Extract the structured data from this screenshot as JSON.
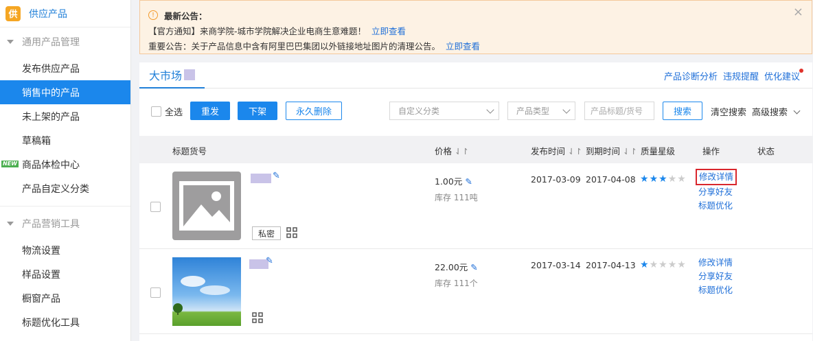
{
  "sidebar": {
    "logo_glyph": "供",
    "header_label": "供应产品",
    "groups": [
      {
        "label": "通用产品管理",
        "items": [
          "发布供应产品",
          "销售中的产品",
          "未上架的产品",
          "草稿箱",
          "商品体检中心",
          "产品自定义分类"
        ]
      },
      {
        "label": "产品营销工具",
        "items": [
          "物流设置",
          "样品设置",
          "橱窗产品",
          "标题优化工具"
        ]
      }
    ],
    "active_item": "销售中的产品",
    "new_badge": "NEW"
  },
  "notice": {
    "title": "最新公告：",
    "line1": "【官方通知】来商学院-城市学院解决企业电商生意难题！",
    "line1_link": "立即查看",
    "line2": "重要公告：关于产品信息中含有阿里巴巴集团以外链接地址图片的清理公告。",
    "line2_link": "立即查看",
    "close_glyph": "×",
    "warn_glyph": "!"
  },
  "tabs": {
    "active": "大市场"
  },
  "top_links": {
    "diagnose": "产品诊断分析",
    "violation": "违规提醒",
    "optimize": "优化建议"
  },
  "toolbar": {
    "select_all": "全选",
    "republish": "重发",
    "delist": "下架",
    "delete_forever": "永久删除",
    "category_placeholder": "自定义分类",
    "type_placeholder": "产品类型",
    "search_placeholder": "产品标题/货号",
    "search_button": "搜索",
    "clear_search": "清空搜索",
    "advanced_search": "高级搜索"
  },
  "table": {
    "headers": {
      "title": "标题货号",
      "price": "价格",
      "publish_time": "发布时间",
      "expire_time": "到期时间",
      "quality": "质量星级",
      "actions": "操作",
      "status": "状态"
    },
    "sort_glyph": "⇃↾",
    "rows": [
      {
        "price": "1.00元",
        "stock": "库存 111吨",
        "publish": "2017-03-09",
        "expire": "2017-04-08",
        "stars": 3,
        "private_tag": "私密",
        "actions": [
          "修改详情",
          "分享好友",
          "标题优化"
        ]
      },
      {
        "price": "22.00元",
        "stock": "库存 111个",
        "publish": "2017-03-14",
        "expire": "2017-04-13",
        "stars": 1,
        "actions": [
          "修改详情",
          "分享好友",
          "标题优化"
        ]
      }
    ]
  },
  "colors": {
    "accent": "#1b87ec",
    "link": "#1f6fd8",
    "highlight_border": "#d9262c",
    "notice_bg": "#fdf2e4"
  }
}
